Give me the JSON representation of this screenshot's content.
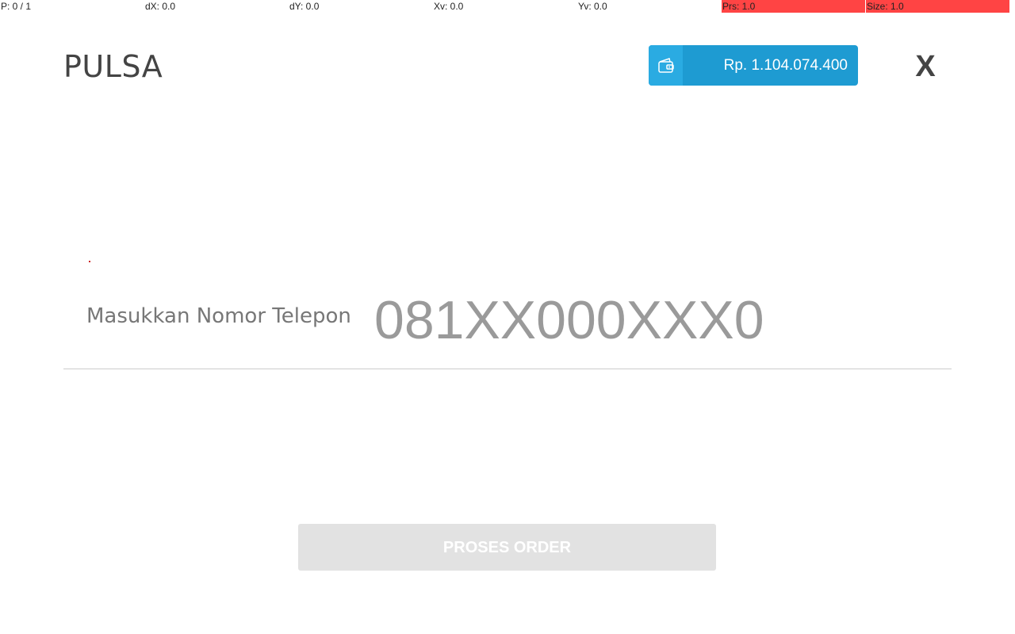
{
  "debug": {
    "pointer": "P: 0 / 1",
    "dx": "dX: 0.0",
    "dy": "dY: 0.0",
    "xv": "Xv: 0.0",
    "yv": "Yv: 0.0",
    "prs": "Prs: 1.0",
    "size": "Size: 1.0"
  },
  "header": {
    "title": "PULSA",
    "close_label": "X"
  },
  "wallet": {
    "icon": "wallet-icon",
    "balance": "Rp. 1.104.074.400",
    "color_main": "#1e9bd2",
    "color_icon_bg": "#2aabe2"
  },
  "form": {
    "phone_label": "Masukkan Nomor Telepon",
    "phone_placeholder": "081XX000XXX0",
    "phone_value": ""
  },
  "actions": {
    "submit_label": "PROSES ORDER",
    "submit_disabled": true
  }
}
